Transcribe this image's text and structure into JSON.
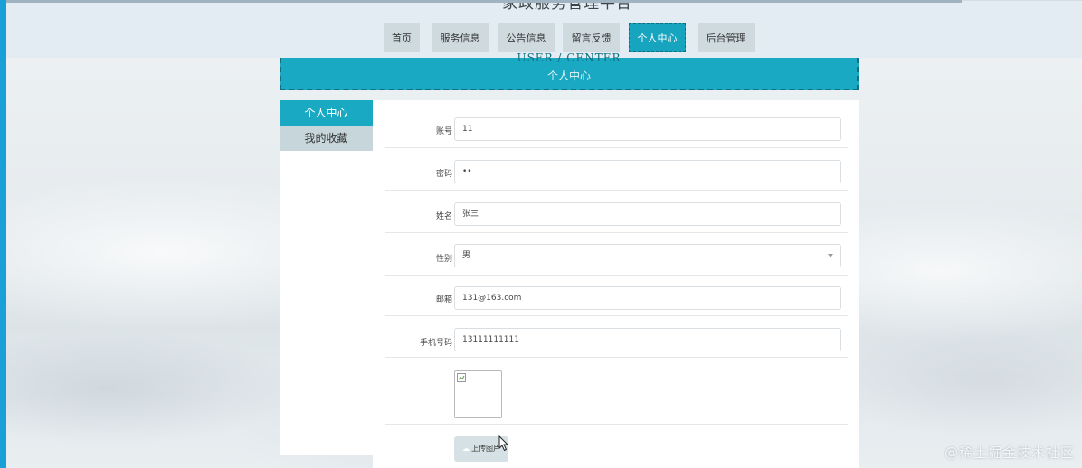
{
  "site": {
    "title": "家政服务管理平台"
  },
  "nav": {
    "items": [
      {
        "label": "首页",
        "active": false
      },
      {
        "label": "服务信息",
        "active": false
      },
      {
        "label": "公告信息",
        "active": false
      },
      {
        "label": "留言反馈",
        "active": false
      },
      {
        "label": "个人中心",
        "active": true
      },
      {
        "label": "后台管理",
        "active": false
      }
    ]
  },
  "banner": {
    "title_en": "USER / CENTER",
    "title_cn": "个人中心"
  },
  "sidebar": {
    "items": [
      {
        "label": "个人中心",
        "active": true
      },
      {
        "label": "我的收藏",
        "active": false
      }
    ]
  },
  "form": {
    "account": {
      "label": "账号",
      "value": "11"
    },
    "password": {
      "label": "密码",
      "value": "••"
    },
    "name": {
      "label": "姓名",
      "value": "张三"
    },
    "gender": {
      "label": "性别",
      "value": "男"
    },
    "email": {
      "label": "邮箱",
      "value": "131@163.com"
    },
    "phone": {
      "label": "手机号码",
      "value": "13111111111"
    },
    "upload_label": "上传图片"
  },
  "watermark": "@稀土掘金技术社区",
  "colors": {
    "accent": "#19a9c2",
    "nav_bg": "#cfdadf",
    "strip": "#1aa0d6"
  }
}
